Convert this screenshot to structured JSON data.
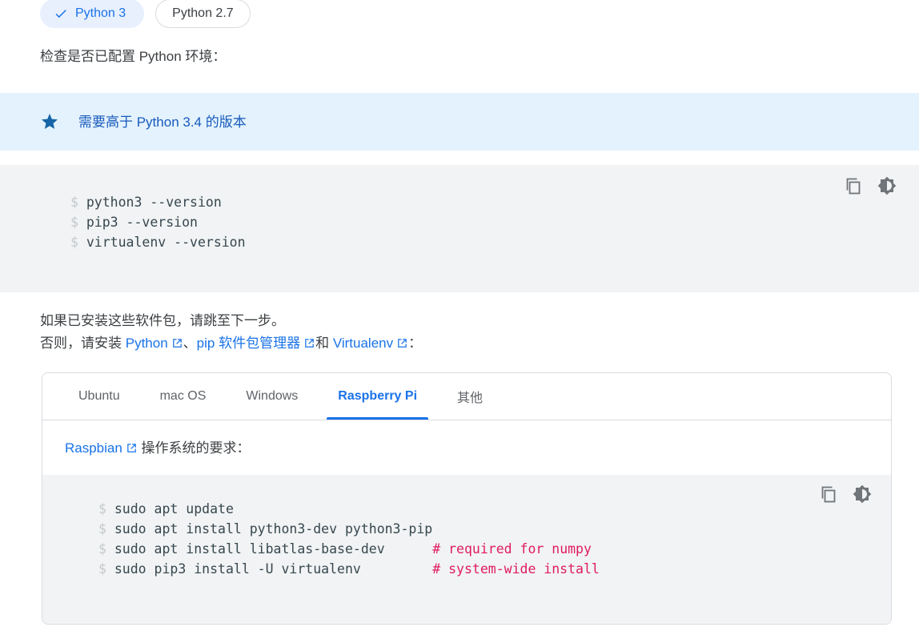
{
  "version_chips": [
    {
      "label": "Python 3",
      "active": true,
      "icon": "check-icon"
    },
    {
      "label": "Python 2.7",
      "active": false
    }
  ],
  "intro_text": "检查是否已配置 Python 环境：",
  "callout": {
    "icon": "star-icon",
    "text": "需要高于 Python 3.4 的版本",
    "bg_color": "#e3f2fd",
    "text_color": "#185abc"
  },
  "code_block_1": {
    "copy_icon": "copy-icon",
    "theme_icon": "brightness-icon",
    "lines": [
      {
        "prompt": "$",
        "command": "python3 --version"
      },
      {
        "prompt": "$",
        "command": "pip3 --version"
      },
      {
        "prompt": "$",
        "command": "virtualenv --version"
      }
    ]
  },
  "body_paragraph": {
    "line1": "如果已安装这些软件包，请跳至下一步。",
    "line2_prefix": "否则，请安装 ",
    "link_python": "Python",
    "sep1": "、",
    "link_pip": "pip 软件包管理器",
    "sep2": "和 ",
    "link_virtualenv": "Virtualenv",
    "suffix": "："
  },
  "tabs": [
    {
      "label": "Ubuntu",
      "active": false
    },
    {
      "label": "mac OS",
      "active": false
    },
    {
      "label": "Windows",
      "active": false
    },
    {
      "label": "Raspberry Pi",
      "active": true
    },
    {
      "label": "其他",
      "active": false
    }
  ],
  "tab_panel": {
    "link_label": "Raspbian",
    "text_after_link": " 操作系统的要求：",
    "code_block_2": {
      "copy_icon": "copy-icon",
      "theme_icon": "brightness-icon",
      "lines": [
        {
          "prompt": "$",
          "command": "sudo apt update",
          "comment": ""
        },
        {
          "prompt": "$",
          "command": "sudo apt install python3-dev python3-pip",
          "comment": ""
        },
        {
          "prompt": "$",
          "command": "sudo apt install libatlas-base-dev",
          "comment": "# required for numpy"
        },
        {
          "prompt": "$",
          "command": "sudo pip3 install -U virtualenv",
          "comment": "# system-wide install"
        }
      ]
    }
  },
  "colors": {
    "accent_blue": "#1a73e8",
    "chip_active_bg": "#e8f0fe",
    "code_bg": "#f1f3f4",
    "comment_pink": "#e01b60",
    "prompt_gray": "#c5c9cc",
    "border_gray": "#dadce0"
  }
}
